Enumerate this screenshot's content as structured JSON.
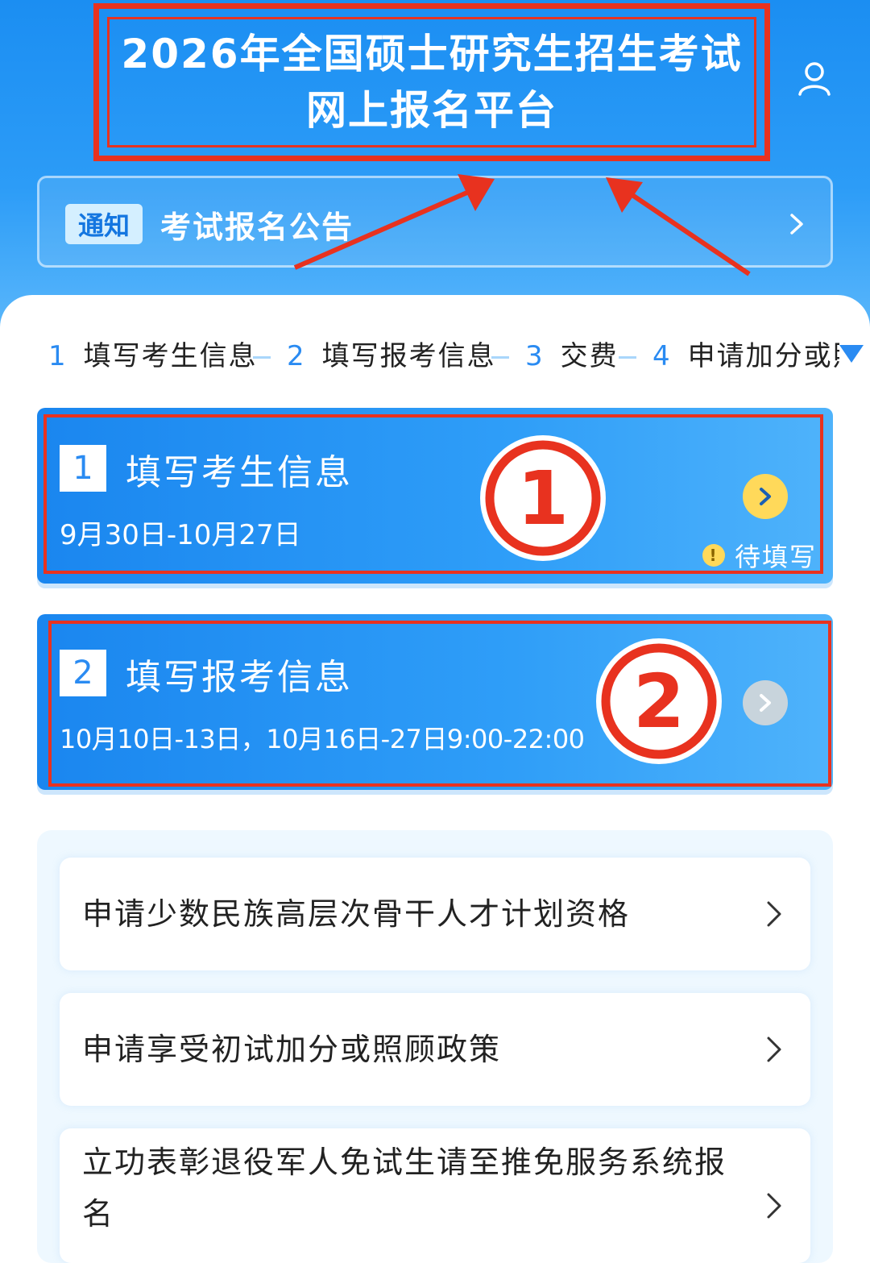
{
  "header": {
    "title_line1": "2026年全国硕士研究生招生考试",
    "title_line2": "网上报名平台",
    "user_icon": "user-icon"
  },
  "notice": {
    "tag": "通知",
    "text": "考试报名公告",
    "chevron_icon": "chevron-right-icon"
  },
  "steps": [
    {
      "num": "1",
      "label": "填写考生信息"
    },
    {
      "num": "2",
      "label": "填写报考信息"
    },
    {
      "num": "3",
      "label": "交费"
    },
    {
      "num": "4",
      "label": "申请加分或照"
    }
  ],
  "cards": [
    {
      "num": "1",
      "title": "填写考生信息",
      "date": "9月30日-10月27日",
      "badge": "①",
      "status": "待填写",
      "status_icon": "!"
    },
    {
      "num": "2",
      "title": "填写报考信息",
      "date": "10月10日-13日，10月16日-27日9:00-22:00",
      "badge": "②"
    }
  ],
  "list": [
    {
      "label": "申请少数民族高层次骨干人才计划资格"
    },
    {
      "label": "申请享受初试加分或照顾政策"
    },
    {
      "label_line1": "立功表彰退役军人免试生请至推免服务系统报",
      "label_line2": "名"
    }
  ],
  "colors": {
    "primary_blue": "#1b8ef2",
    "annotation_red": "#e8321f",
    "active_button": "#ffd95a",
    "disabled_button": "#c8d4dc"
  }
}
